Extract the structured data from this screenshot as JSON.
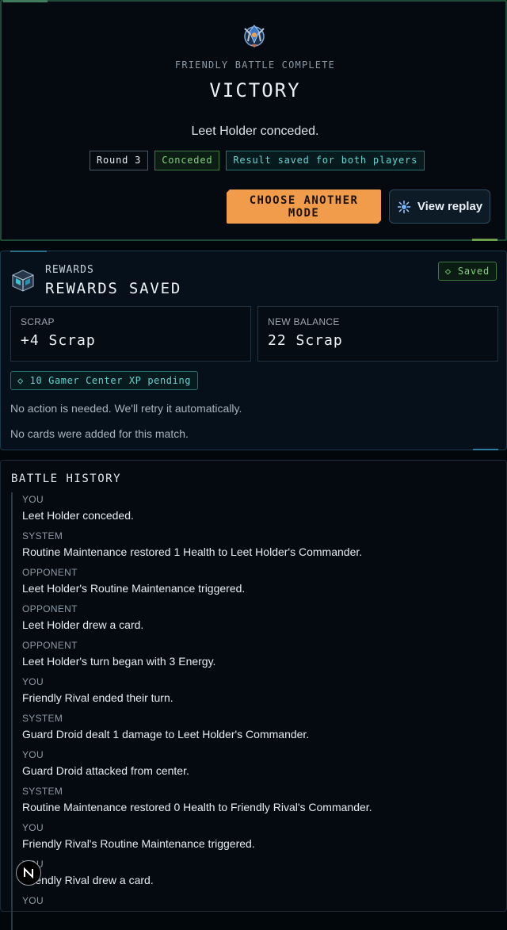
{
  "victory": {
    "kicker": "FRIENDLY BATTLE COMPLETE",
    "title": "VICTORY",
    "message": "Leet Holder conceded.",
    "chips": {
      "round": "Round 3",
      "status": "Conceded",
      "saved": "Result saved for both players"
    },
    "actions": {
      "primary": "CHOOSE ANOTHER MODE",
      "secondary": "View replay"
    }
  },
  "rewards": {
    "kicker": "REWARDS",
    "title": "REWARDS SAVED",
    "badge": "◇ Saved",
    "scrap_label": "SCRAP",
    "scrap_value": "+4 Scrap",
    "balance_label": "NEW BALANCE",
    "balance_value": "22 Scrap",
    "xp_pending": "◇ 10 Gamer Center XP pending",
    "note_retry": "No action is needed. We'll retry it automatically.",
    "note_cards": "No cards were added for this match."
  },
  "history": {
    "title": "BATTLE HISTORY",
    "entries": [
      {
        "actor": "YOU",
        "text": "Leet Holder conceded."
      },
      {
        "actor": "SYSTEM",
        "text": "Routine Maintenance restored 1 Health to Leet Holder's Commander."
      },
      {
        "actor": "OPPONENT",
        "text": "Leet Holder's Routine Maintenance triggered."
      },
      {
        "actor": "OPPONENT",
        "text": "Leet Holder drew a card."
      },
      {
        "actor": "OPPONENT",
        "text": "Leet Holder's turn began with 3 Energy."
      },
      {
        "actor": "YOU",
        "text": "Friendly Rival ended their turn."
      },
      {
        "actor": "SYSTEM",
        "text": "Guard Droid dealt 1 damage to Leet Holder's Commander."
      },
      {
        "actor": "YOU",
        "text": "Guard Droid attacked from center."
      },
      {
        "actor": "SYSTEM",
        "text": "Routine Maintenance restored 0 Health to Friendly Rival's Commander."
      },
      {
        "actor": "YOU",
        "text": "Friendly Rival's Routine Maintenance triggered."
      },
      {
        "actor": "YOU",
        "text": "Friendly Rival drew a card."
      },
      {
        "actor": "YOU",
        "text": ""
      }
    ]
  },
  "avatar": {
    "letter": "N"
  },
  "icons": {
    "trophy": "trophy-emblem-icon",
    "replay": "replay-icon",
    "crate": "reward-crate-icon"
  },
  "colors": {
    "accent_orange": "#f09c4a",
    "success_green": "#7ed37a",
    "teal": "#66d2cf",
    "background": "#02070c"
  }
}
